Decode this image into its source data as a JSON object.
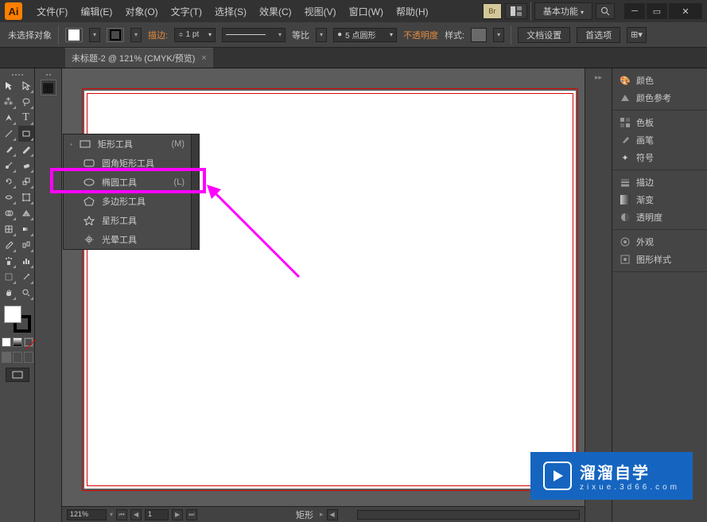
{
  "app": {
    "name": "Ai"
  },
  "menu": {
    "file": "文件(F)",
    "edit": "编辑(E)",
    "object": "对象(O)",
    "type": "文字(T)",
    "select": "选择(S)",
    "effect": "效果(C)",
    "view": "视图(V)",
    "window": "窗口(W)",
    "help": "帮助(H)"
  },
  "workspace": {
    "label": "基本功能"
  },
  "options": {
    "no_selection": "未选择对象",
    "stroke_label": "描边:",
    "stroke_value": "1 pt",
    "uniform": "等比",
    "brush_value": "5 点圆形",
    "opacity_label": "不透明度",
    "style_label": "样式:",
    "doc_setup": "文档设置",
    "preferences": "首选项"
  },
  "doc_tab": {
    "title": "未标题-2 @ 121% (CMYK/预览)"
  },
  "flyout": {
    "rectangle": "矩形工具",
    "rectangle_key": "(M)",
    "rounded": "圆角矩形工具",
    "ellipse": "椭圆工具",
    "ellipse_key": "(L)",
    "polygon": "多边形工具",
    "star": "星形工具",
    "flare": "光晕工具"
  },
  "panels": {
    "color": "颜色",
    "color_guide": "颜色参考",
    "swatches": "色板",
    "brushes": "画笔",
    "symbols": "符号",
    "stroke": "描边",
    "gradient": "渐变",
    "transparency": "透明度",
    "appearance": "外观",
    "graphic_styles": "图形样式"
  },
  "status": {
    "zoom": "121%",
    "page": "1",
    "tool": "矩形"
  },
  "watermark": {
    "main": "溜溜自学",
    "sub": "zixue.3d66.com"
  },
  "colors": {
    "accent": "#ff00ff",
    "artboard_border": "#d00",
    "brand_blue": "#1565c0"
  }
}
